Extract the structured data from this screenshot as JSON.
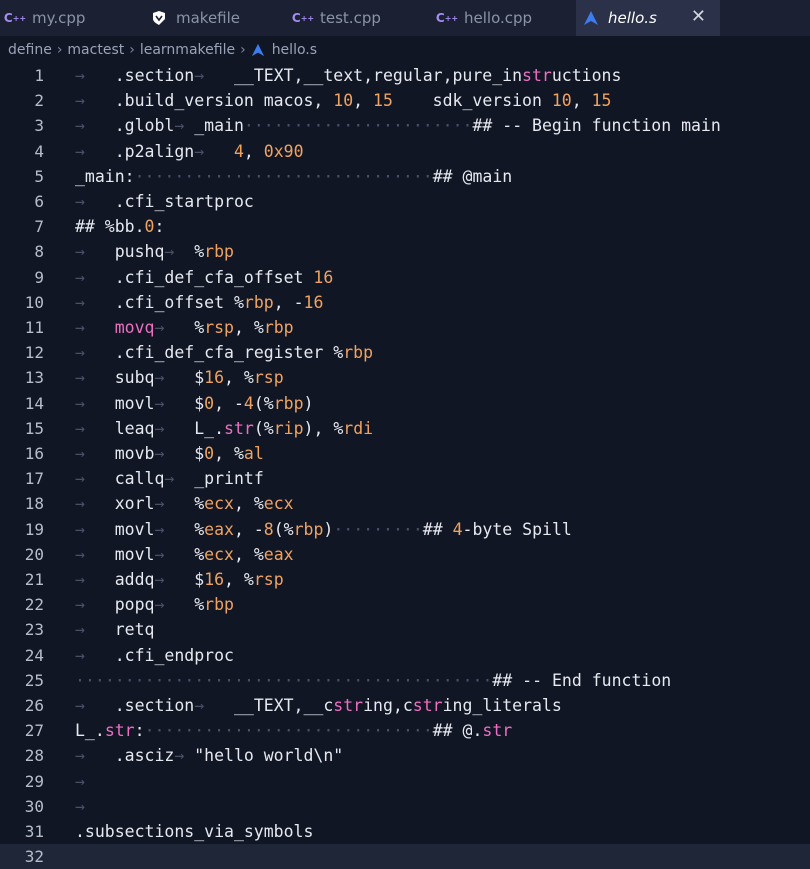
{
  "tabs": [
    {
      "icon": "cpp-icon",
      "label": "my.cpp",
      "active": false
    },
    {
      "icon": "makefile-icon",
      "label": "makefile",
      "active": false
    },
    {
      "icon": "cpp-icon",
      "label": "test.cpp",
      "active": false
    },
    {
      "icon": "cpp-icon",
      "label": "hello.cpp",
      "active": false
    },
    {
      "icon": "assembly-icon",
      "label": "hello.s",
      "active": true
    }
  ],
  "breadcrumb": [
    "define",
    "mactest",
    "learnmakefile",
    "hello.s"
  ],
  "colors": {
    "number": "#f0a35e",
    "keyword": "#ec6fc1",
    "active_tab": "#2b3149",
    "background": "#111625"
  },
  "editor": {
    "current_line": 32,
    "lines": [
      {
        "num": "1",
        "code": "→   .section→   __TEXT,__text,regular,pure_instructions"
      },
      {
        "num": "2",
        "code": "→   .build_version macos, 10, 15    sdk_version 10, 15"
      },
      {
        "num": "3",
        "code": "→   .globl→ _main·······················## -- Begin function main"
      },
      {
        "num": "4",
        "code": "→   .p2align→   4, 0x90"
      },
      {
        "num": "5",
        "code": "_main:······························## @main"
      },
      {
        "num": "6",
        "code": "→   .cfi_startproc"
      },
      {
        "num": "7",
        "code": "## %bb.0:"
      },
      {
        "num": "8",
        "code": "→   pushq→  %rbp"
      },
      {
        "num": "9",
        "code": "→   .cfi_def_cfa_offset 16"
      },
      {
        "num": "10",
        "code": "→   .cfi_offset %rbp, -16"
      },
      {
        "num": "11",
        "code": "→   movq→   %rsp, %rbp"
      },
      {
        "num": "12",
        "code": "→   .cfi_def_cfa_register %rbp"
      },
      {
        "num": "13",
        "code": "→   subq→   $16, %rsp"
      },
      {
        "num": "14",
        "code": "→   movl→   $0, -4(%rbp)"
      },
      {
        "num": "15",
        "code": "→   leaq→   L_.str(%rip), %rdi"
      },
      {
        "num": "16",
        "code": "→   movb→   $0, %al"
      },
      {
        "num": "17",
        "code": "→   callq→  _printf"
      },
      {
        "num": "18",
        "code": "→   xorl→   %ecx, %ecx"
      },
      {
        "num": "19",
        "code": "→   movl→   %eax, -8(%rbp)·········## 4-byte Spill"
      },
      {
        "num": "20",
        "code": "→   movl→   %ecx, %eax"
      },
      {
        "num": "21",
        "code": "→   addq→   $16, %rsp"
      },
      {
        "num": "22",
        "code": "→   popq→   %rbp"
      },
      {
        "num": "23",
        "code": "→   retq"
      },
      {
        "num": "24",
        "code": "→   .cfi_endproc"
      },
      {
        "num": "25",
        "code": "··········································## -- End function"
      },
      {
        "num": "26",
        "code": "→   .section→   __TEXT,__cstring,cstring_literals"
      },
      {
        "num": "27",
        "code": "L_.str:·····························## @.str"
      },
      {
        "num": "28",
        "code": "→   .asciz→ \"hello world\\n\""
      },
      {
        "num": "29",
        "code": "→"
      },
      {
        "num": "30",
        "code": "→"
      },
      {
        "num": "31",
        "code": ".subsections_via_symbols"
      },
      {
        "num": "32",
        "code": ""
      }
    ]
  }
}
